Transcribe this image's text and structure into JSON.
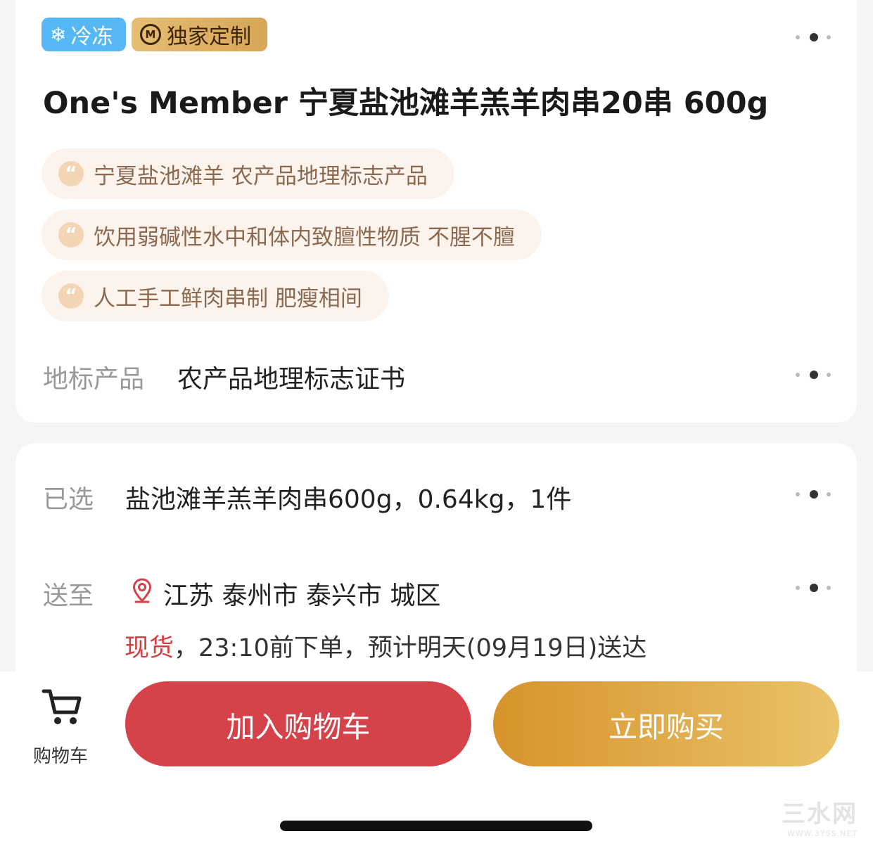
{
  "badges": {
    "frozen": "冷冻",
    "exclusive": "独家定制"
  },
  "product": {
    "title": "One's Member 宁夏盐池滩羊羔羊肉串20串  600g",
    "features": [
      "宁夏盐池滩羊 农产品地理标志产品",
      "饮用弱碱性水中和体内致膻性物质 不腥不膻",
      "人工手工鲜肉串制 肥瘦相间"
    ],
    "geo_label": "地标产品",
    "geo_value": "农产品地理标志证书"
  },
  "options": {
    "selected_label": "已选",
    "selected_value": "盐池滩羊羔羊肉串600g，0.64kg，1件",
    "ship_label": "送至",
    "ship_value": "江苏  泰州市  泰兴市  城区",
    "stock_status": "现货",
    "delivery_text": "，23:10前下单，预计明天(09月19日)送达"
  },
  "bottom_bar": {
    "cart_label": "购物车",
    "add_to_cart": "加入购物车",
    "buy_now": "立即购买"
  },
  "watermark": {
    "brand": "三水网",
    "url": "WWW.3YSS.NET"
  },
  "colors": {
    "frozen_badge": "#55b8f5",
    "add_to_cart": "#d5424a",
    "buy_now": "#e0a847",
    "stock_status": "#d23d3d"
  }
}
